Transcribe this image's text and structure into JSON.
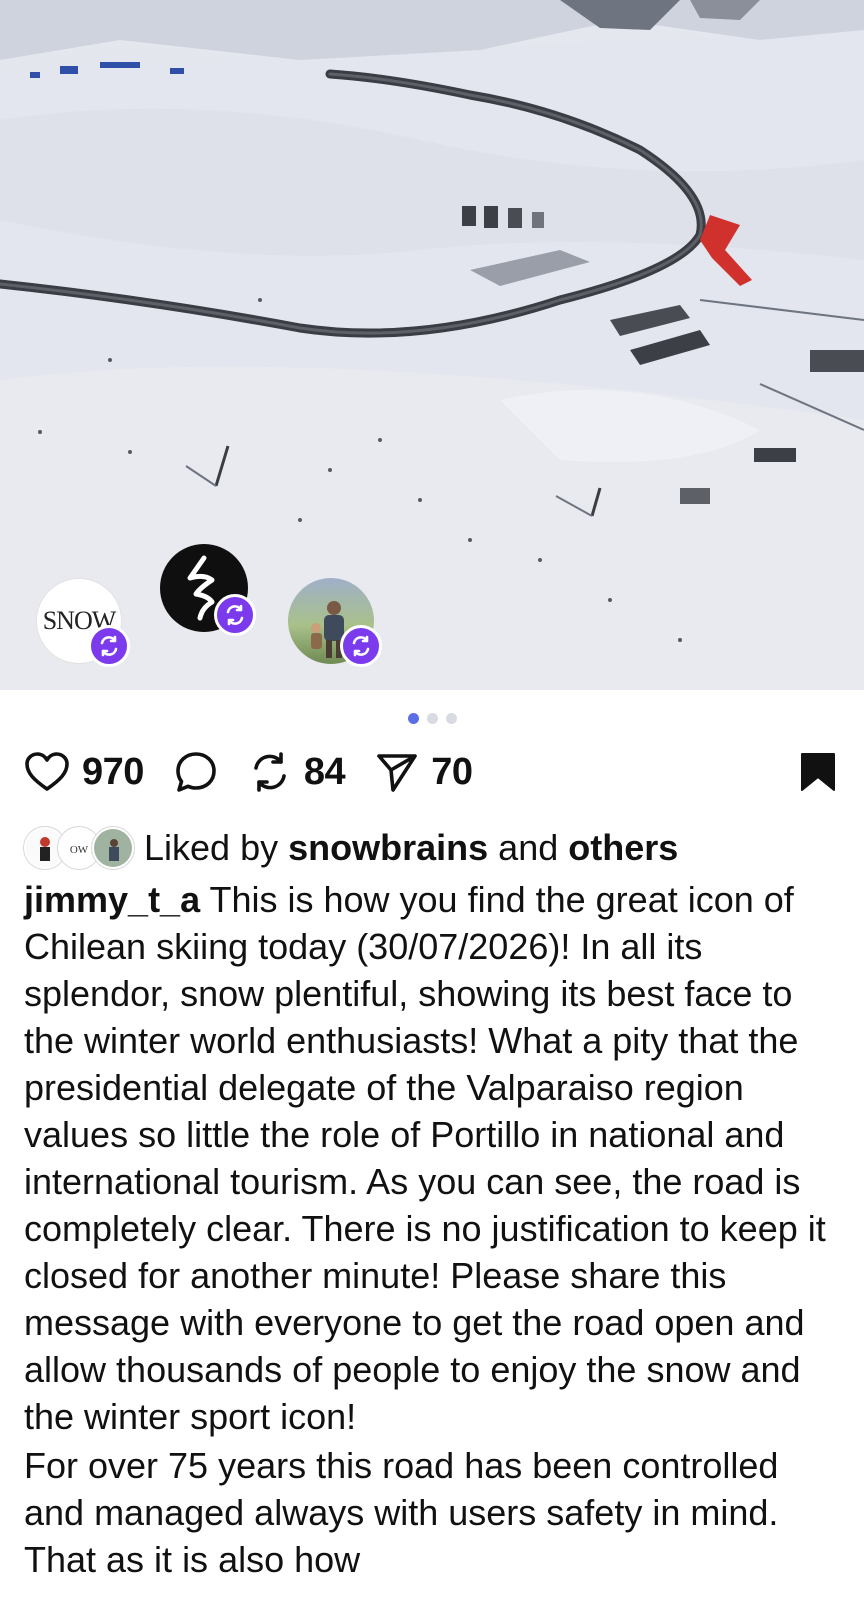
{
  "post": {
    "media": {
      "description_icon": "photo",
      "reposters": [
        {
          "name": "snow-reposter",
          "label": "SNOW"
        },
        {
          "name": "snowbrains-reposter",
          "label": ""
        },
        {
          "name": "person-reposter",
          "label": ""
        }
      ],
      "pager": {
        "count": 3,
        "active_index": 0
      }
    },
    "actions": {
      "likes": "970",
      "reposts": "84",
      "shares": "70"
    },
    "liked_by": {
      "prefix": "Liked by",
      "user": "snowbrains",
      "joiner": "and",
      "others": "others"
    },
    "caption": {
      "username": "jimmy_t_a",
      "text_1": "This is how you find the great icon of Chilean skiing today (30/07/2026)! In all its splendor, snow plentiful, showing its best face to the winter world enthusiasts! What a pity that the presidential delegate of the Valparaiso region values so little the role of Portillo in national and international tourism. As you can see, the road is completely clear. There is no justification to keep it closed for another minute! Please share this message with everyone to get the road open and allow thousands of people to enjoy the snow and the winter sport icon!",
      "text_2": "For over 75 years this road has been controlled and managed always with users safety in mind. That as it is also how"
    }
  },
  "colors": {
    "accent": "#5b6ee8",
    "repost_badge": "#7c3aed",
    "text": "#111111"
  }
}
